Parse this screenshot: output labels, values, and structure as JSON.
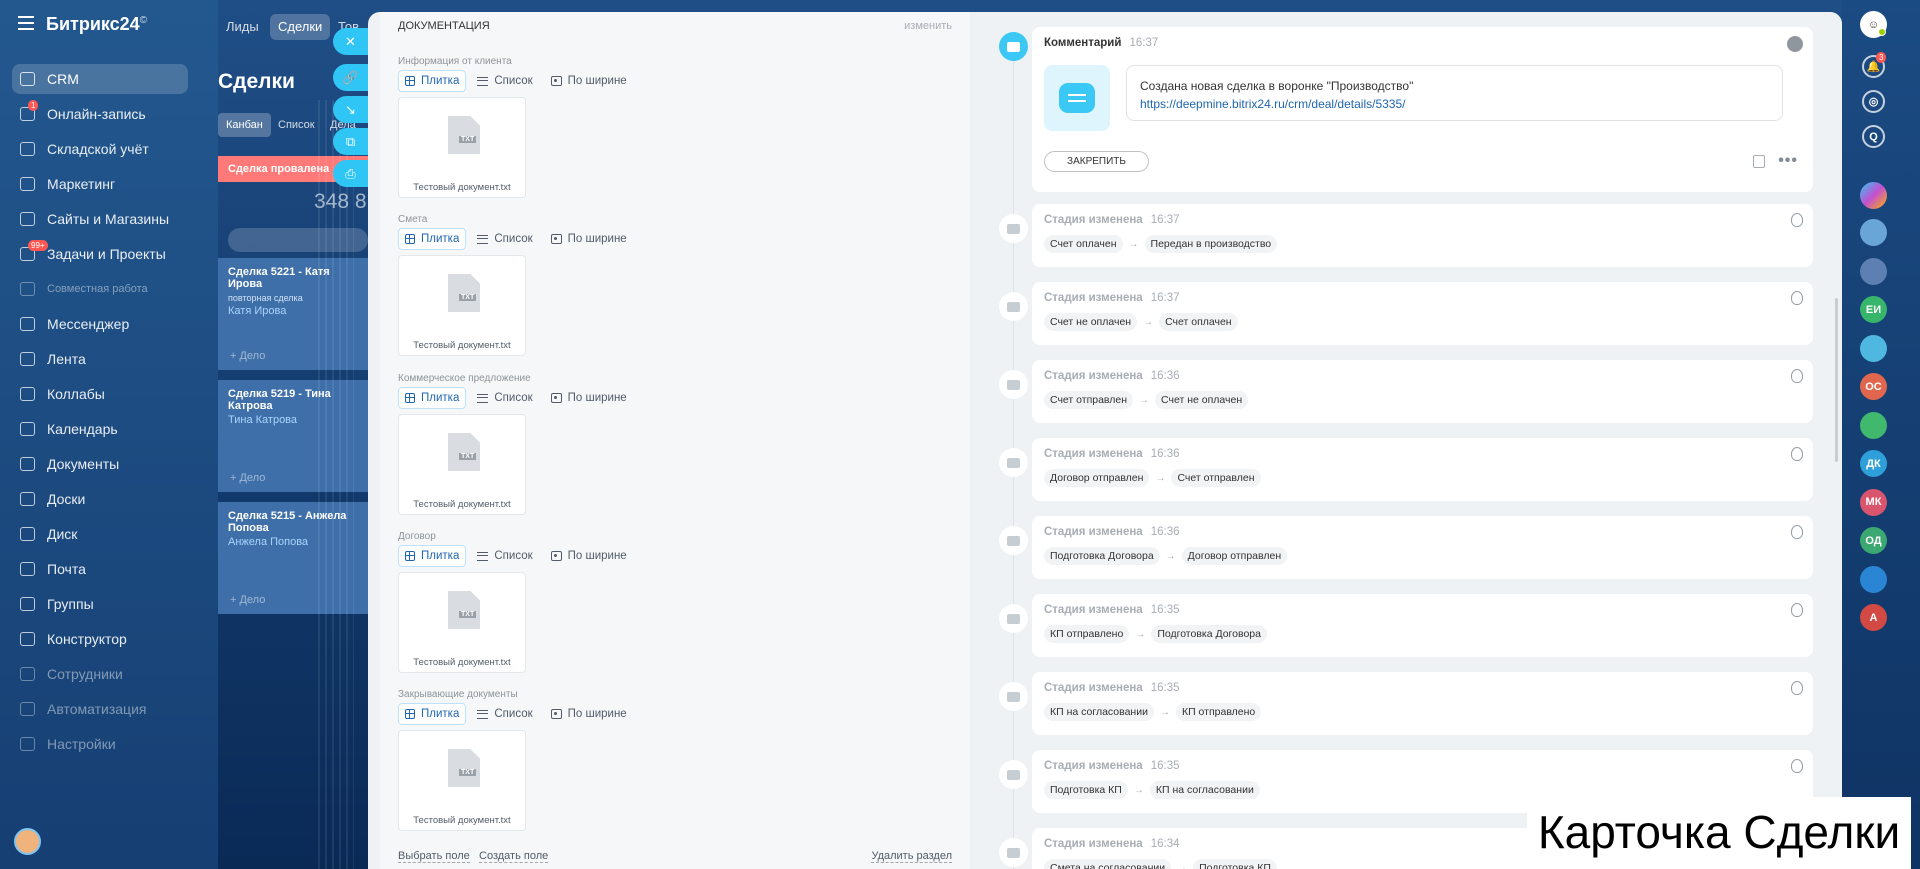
{
  "bg": {
    "logo": "Битрикс24",
    "logo_sup": "©",
    "sidebar": [
      {
        "label": "CRM",
        "active": true
      },
      {
        "label": "Онлайн-запись",
        "badge": "1"
      },
      {
        "label": "Складской учёт"
      },
      {
        "label": "Маркетинг"
      },
      {
        "label": "Сайты и Магазины"
      },
      {
        "label": "Задачи и Проекты",
        "badge": "99+"
      },
      {
        "label": "Совместная работа",
        "dim": true
      },
      {
        "label": "Мессенджер"
      },
      {
        "label": "Лента"
      },
      {
        "label": "Коллабы"
      },
      {
        "label": "Календарь"
      },
      {
        "label": "Документы"
      },
      {
        "label": "Доски"
      },
      {
        "label": "Диск"
      },
      {
        "label": "Почта"
      },
      {
        "label": "Группы"
      },
      {
        "label": "Конструктор"
      },
      {
        "label": "Сотрудники",
        "dim": true
      },
      {
        "label": "Автоматизация",
        "dim": true
      },
      {
        "label": "Настройки",
        "dim": true
      }
    ],
    "top_tabs": [
      "Лиды",
      "Сделки",
      "Тов"
    ],
    "page_title": "Сделки",
    "view_tabs": [
      "Канбан",
      "Список",
      "Дела"
    ],
    "stage_title": "Сделка провалена",
    "stage_sum": "348 8",
    "cards": [
      {
        "title": "Сделка 5221 - Катя Ирова",
        "sub": "повторная сделка",
        "name": "Катя Ирова",
        "todo": "+ Дело"
      },
      {
        "title": "Сделка 5219 - Тина Катрова",
        "sub": "",
        "name": "Тина Катрова",
        "todo": "+ Дело"
      },
      {
        "title": "Сделка 5215 - Анжела Попова",
        "sub": "",
        "name": "Анжела Попова",
        "todo": "+ Дело"
      }
    ]
  },
  "docs": {
    "title": "Документация",
    "edit": "изменить",
    "modes": [
      "Плитка",
      "Список",
      "По ширине"
    ],
    "sections": [
      {
        "label": "Информация от клиента",
        "file": "Тестовый документ.txt",
        "ext": "TXT"
      },
      {
        "label": "Смета",
        "file": "Тестовый документ.txt",
        "ext": "TXT"
      },
      {
        "label": "Коммерческое предложение",
        "file": "Тестовый документ.txt",
        "ext": "TXT"
      },
      {
        "label": "Договор",
        "file": "Тестовый документ.txt",
        "ext": "TXT"
      },
      {
        "label": "Закрывающие документы",
        "file": "Тестовый документ.txt",
        "ext": "TXT"
      }
    ],
    "footer": {
      "choose": "Выбрать поле",
      "create": "Создать поле",
      "delete": "Удалить раздел"
    }
  },
  "timeline": {
    "comment": {
      "title": "Комментарий",
      "time": "16:37",
      "text": "Создана новая сделка в воронке \"Производство\"",
      "link": "https://deepmine.bitrix24.ru/crm/deal/details/5335/",
      "pin": "ЗАКРЕПИТЬ"
    },
    "events": [
      {
        "title": "Стадия изменена",
        "time": "16:37",
        "from": "Счет оплачен",
        "to": "Передан в производство"
      },
      {
        "title": "Стадия изменена",
        "time": "16:37",
        "from": "Счет не оплачен",
        "to": "Счет оплачен"
      },
      {
        "title": "Стадия изменена",
        "time": "16:36",
        "from": "Счет отправлен",
        "to": "Счет не оплачен"
      },
      {
        "title": "Стадия изменена",
        "time": "16:36",
        "from": "Договор отправлен",
        "to": "Счет отправлен"
      },
      {
        "title": "Стадия изменена",
        "time": "16:36",
        "from": "Подготовка Договора",
        "to": "Договор отправлен"
      },
      {
        "title": "Стадия изменена",
        "time": "16:35",
        "from": "КП отправлено",
        "to": "Подготовка Договора"
      },
      {
        "title": "Стадия изменена",
        "time": "16:35",
        "from": "КП на согласовании",
        "to": "КП отправлено"
      },
      {
        "title": "Стадия изменена",
        "time": "16:35",
        "from": "Подготовка КП",
        "to": "КП на согласовании"
      },
      {
        "title": "Стадия изменена",
        "time": "16:34",
        "from": "Смета на согласовании",
        "to": "Подготовка КП"
      }
    ]
  },
  "rail": {
    "notif_badge": "3",
    "avatars": [
      {
        "initials": "",
        "color": "#6aa5d8"
      },
      {
        "initials": "",
        "color": "#5d7fb2"
      },
      {
        "initials": "ЕИ",
        "color": "#37b56b"
      },
      {
        "initials": "",
        "color": "#4fb8e0"
      },
      {
        "initials": "ОС",
        "color": "#e0674e"
      },
      {
        "initials": "",
        "color": "#40b86e"
      },
      {
        "initials": "ДК",
        "color": "#2e9fd8"
      },
      {
        "initials": "МК",
        "color": "#d9556d"
      },
      {
        "initials": "ОД",
        "color": "#3aa870"
      },
      {
        "initials": "",
        "color": "#2a86d4"
      },
      {
        "initials": "А",
        "color": "#d34a44"
      }
    ]
  },
  "caption": "Карточка Сделки"
}
